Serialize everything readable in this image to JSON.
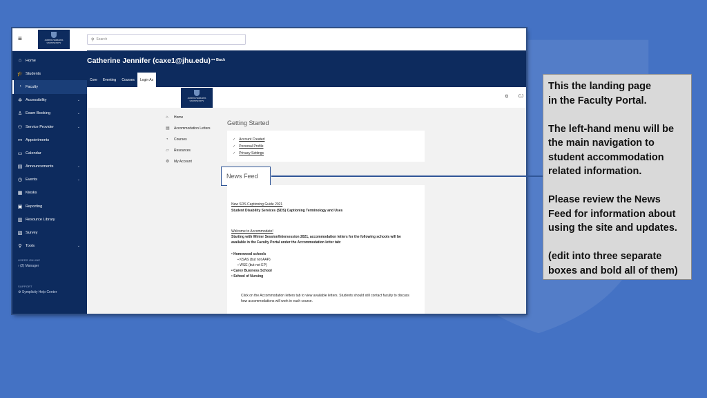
{
  "topbar": {
    "search_placeholder": "Search"
  },
  "sidebar": {
    "items": [
      {
        "label": "Home",
        "icon": "⌂",
        "chevron": false
      },
      {
        "label": "Students",
        "icon": "🎓",
        "chevron": false
      },
      {
        "label": "Faculty",
        "icon": "◔",
        "chevron": false,
        "active": true
      },
      {
        "label": "Accessibility",
        "icon": "✲",
        "chevron": true
      },
      {
        "label": "Exam Booking",
        "icon": "♙",
        "chevron": true
      },
      {
        "label": "Service Provider",
        "icon": "⚇",
        "chevron": true
      },
      {
        "label": "Appointments",
        "icon": "⚯",
        "chevron": false
      },
      {
        "label": "Calendar",
        "icon": "▭",
        "chevron": false
      },
      {
        "label": "Announcements",
        "icon": "▤",
        "chevron": true
      },
      {
        "label": "Events",
        "icon": "◷",
        "chevron": true
      },
      {
        "label": "Kiosks",
        "icon": "▦",
        "chevron": false
      },
      {
        "label": "Reporting",
        "icon": "▣",
        "chevron": false
      },
      {
        "label": "Resource Library",
        "icon": "▥",
        "chevron": false
      },
      {
        "label": "Survey",
        "icon": "▧",
        "chevron": false
      },
      {
        "label": "Tools",
        "icon": "⚲",
        "chevron": true
      }
    ],
    "users_online_label": "USERS ONLINE",
    "users_online_item": "(2) Manager",
    "support_label": "SUPPORT",
    "support_item": "Symplicity Help Center"
  },
  "banner": {
    "user_name": "Catherine Jennifer (caxe1@jhu.edu)",
    "back_label": "Back",
    "tabs": [
      "Core",
      "Eventing",
      "Courses",
      "Login As"
    ]
  },
  "header": {
    "initials": "CJ"
  },
  "left_menu": [
    {
      "label": "Home",
      "icon": "⌂"
    },
    {
      "label": "Accommodation Letters",
      "icon": "▤"
    },
    {
      "label": "Courses",
      "icon": "◔"
    },
    {
      "label": "Resources",
      "icon": "▱"
    },
    {
      "label": "My Account",
      "icon": "⚙"
    }
  ],
  "getting_started": {
    "title": "Getting Started",
    "items": [
      "Account Created",
      "Personal Profile",
      "Privacy Settings"
    ]
  },
  "news_feed": {
    "title": "News Feed",
    "guide_link": "New SDS Captioning Guide 2021",
    "guide_title": "Student Disability Services (SDS) Captioning Terminology and Uses",
    "welcome_link": "Welcome to Accommodate!",
    "welcome_text": "Starting with Winter Session/Intersession 2021, accommodation letters for the following schools will be available in the Faculty Portal under the Accommodation letter tab:",
    "schools": [
      "Homewood schools",
      "KSAS (but not AAP)",
      "WSE (but not EP)",
      "Carey Business School",
      "School of Nursing"
    ],
    "instructions": "Click on the Accommodation letters tab to view available letters. Students should still contact faculty to discuss how accommodations will work in each course."
  },
  "logo_text": "JOHNS HOPKINS UNIVERSITY",
  "callout": {
    "p1": "This the landing page\n in the Faculty Portal.",
    "p2": "The left-hand menu will be the main navigation to student accommodation related information.",
    "p3": "Please review the News Feed for information about using the site and updates.",
    "p4": "(edit into three separate boxes and bold all of them)"
  }
}
